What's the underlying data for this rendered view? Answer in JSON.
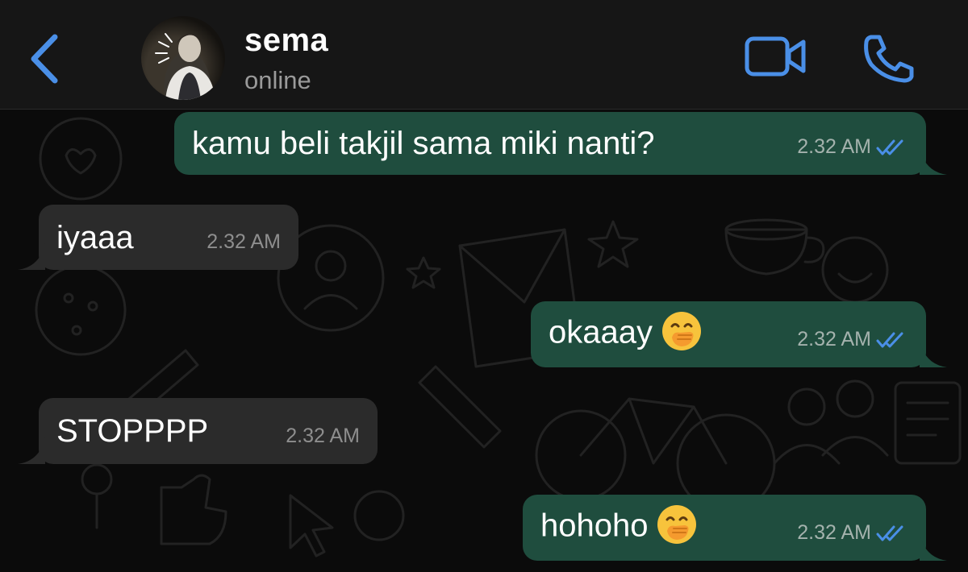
{
  "header": {
    "contact_name": "sema",
    "status": "online",
    "icons": {
      "back": "chevron-left-icon",
      "video": "video-call-icon",
      "call": "phone-icon"
    },
    "accent_color": "#4a8fe7"
  },
  "messages": [
    {
      "direction": "outgoing",
      "text": "kamu beli takjil sama miki nanti?",
      "emoji": "",
      "time": "2.32 AM",
      "read": true
    },
    {
      "direction": "incoming",
      "text": "iyaaa",
      "emoji": "",
      "time": "2.32 AM"
    },
    {
      "direction": "outgoing",
      "text": "okaaay",
      "emoji": "face-with-hand-over-mouth",
      "time": "2.32 AM",
      "read": true
    },
    {
      "direction": "incoming",
      "text": "STOPPPP",
      "emoji": "",
      "time": "2.32 AM"
    },
    {
      "direction": "outgoing",
      "text": "hohoho",
      "emoji": "face-with-hand-over-mouth",
      "time": "2.32 AM",
      "read": true
    }
  ],
  "colors": {
    "outgoing_bubble": "#1f4d3e",
    "incoming_bubble": "#2b2b2b",
    "read_ticks": "#4a8fe7",
    "background": "#0b0b0b"
  }
}
